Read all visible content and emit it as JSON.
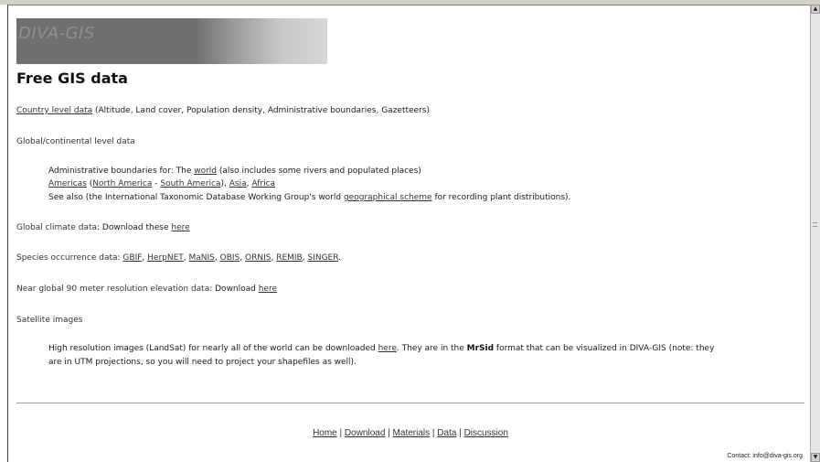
{
  "banner": {
    "title": "DIVA-GIS"
  },
  "page": {
    "title": "Free GIS data"
  },
  "country": {
    "link": "Country level data",
    "desc": " (Altitude, Land cover, Population density, Administrative boundaries, Gazetteers)"
  },
  "global": {
    "heading": "Global/continental level data",
    "admin_prefix": "Administrative boundaries for: The ",
    "world_link": "world",
    "admin_suffix": " (also includes some rivers and populated places)",
    "americas": "Americas",
    "open_paren": " (",
    "north_america": "North America",
    "dash": " - ",
    "south_america": "South America",
    "close_paren_comma": "), ",
    "asia": "Asia",
    "comma": ", ",
    "africa": "Africa",
    "see_also_prefix": "See also (the International Taxonomic Database Working Group's world ",
    "geo_scheme_link": "geographical scheme",
    "see_also_suffix": " for recording plant distributions)."
  },
  "climate": {
    "heading": "Global climate data",
    "text": ": Download these ",
    "link": "here"
  },
  "species": {
    "heading": "Species occurrence data",
    "sep_start": ":  ",
    "links": [
      "GBIF",
      "HerpNET",
      "MaNIS",
      "OBIS",
      "ORNIS",
      "REMIB",
      "SINGER"
    ],
    "end": "."
  },
  "elevation": {
    "heading": "Near global 90 meter resolution elevation data",
    "text": ": Download ",
    "link": "here"
  },
  "satellite": {
    "heading": "Satellite images",
    "line1_prefix": "High resolution images (LandSat) for nearly all of the world can be downloaded ",
    "link": "here",
    "line1_mid": ". They are in the ",
    "bold": "MrSid",
    "line1_suffix": " format that can be visualized in DIVA-GIS (note: they",
    "line2": "are in UTM projections, so you will need to project your shapefiles as well)."
  },
  "footer": {
    "links": [
      "Home",
      "Download",
      "Materials",
      "Data",
      "Discussion"
    ],
    "sep": " | ",
    "sep_wide": "  | ",
    "contact": "Contact: info@diva-gis.org"
  }
}
